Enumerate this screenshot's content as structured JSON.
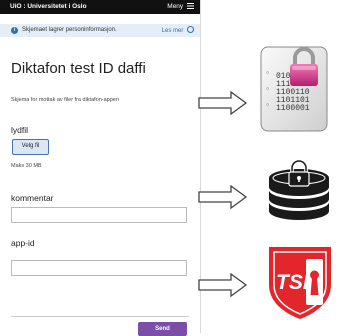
{
  "header": {
    "logo": "UiO : Universitetet i Oslo",
    "menu": "Meny"
  },
  "notice": {
    "message": "Skjemaet lagrer personinformasjon.",
    "more": "Les mer"
  },
  "form": {
    "title": "Diktafon test ID daffi",
    "subtitle": "Skjema for mottak av filer fra diktafon-appen",
    "audio_label": "lydfil",
    "file_button": "Velg fil",
    "max_size": "Maks 30 MB",
    "comment_label": "kommentar",
    "comment_value": "",
    "appid_label": "app-id",
    "appid_value": "",
    "submit": "Send"
  },
  "encrypted_file": {
    "binary_lines": [
      "010",
      "111",
      "1100110",
      "1101101",
      "1100001"
    ]
  },
  "tsd_logo": {
    "text": "TSD"
  },
  "colors": {
    "accent": "#7b4fa8",
    "info": "#2d6fb0",
    "tsd_red": "#e3262b",
    "lock_pink": "#d93a8c"
  },
  "icons": [
    "info-icon",
    "menu-icon",
    "chevron-down-icon",
    "arrow-right-icon",
    "encrypted-file-icon",
    "padlock-icon",
    "locked-database-icon",
    "tsd-shield-logo"
  ]
}
